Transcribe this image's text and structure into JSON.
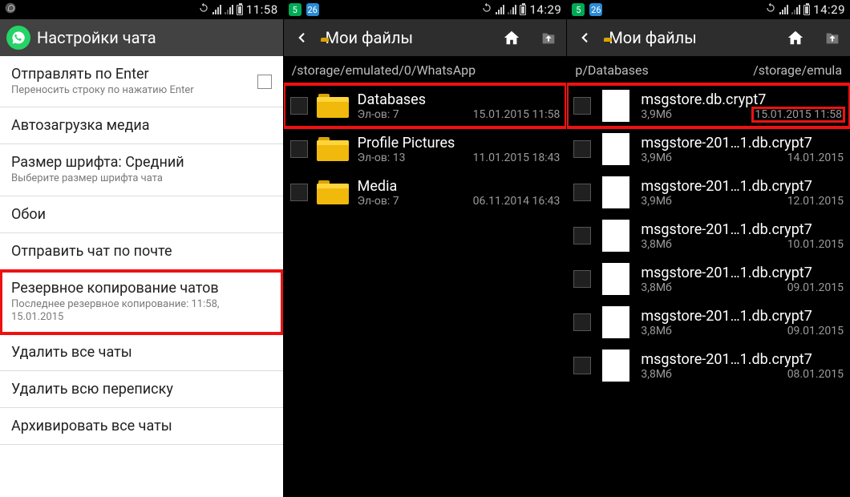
{
  "phone1": {
    "status": {
      "time": "11:58"
    },
    "header": {
      "title": "Настройки чата"
    },
    "items": [
      {
        "title": "Отправлять по Enter",
        "sub": "Переносить строку по нажатию Enter",
        "checkbox": true
      },
      {
        "title": "Автозагрузка медиа"
      },
      {
        "title": "Размер шрифта: Средний",
        "sub": "Выберите размер шрифта чата"
      },
      {
        "title": "Обои"
      },
      {
        "title": "Отправить чат по почте"
      },
      {
        "title": "Резервное копирование чатов",
        "sub": "Последнее резервное копирование: 11:58, 15.01.2015",
        "hl": true
      },
      {
        "title": "Удалить все чаты"
      },
      {
        "title": "Удалить всю переписку"
      },
      {
        "title": "Архивировать все чаты"
      }
    ]
  },
  "phone2": {
    "status": {
      "time": "14:29"
    },
    "header": {
      "title": "Мои файлы"
    },
    "path": "/storage/emulated/0/WhatsApp",
    "rows": [
      {
        "name": "Databases",
        "meta1": "Эл-ов: 7",
        "meta2": "15.01.2015 11:58",
        "hl": true
      },
      {
        "name": "Profile Pictures",
        "meta1": "Эл-ов: 13",
        "meta2": "11.01.2015 18:43"
      },
      {
        "name": "Media",
        "meta1": "Эл-ов: 7",
        "meta2": "06.11.2014 16:43"
      }
    ]
  },
  "phone3": {
    "status": {
      "time": "14:29"
    },
    "header": {
      "title": "Мои файлы"
    },
    "path1": "p/Databases",
    "path2": "/storage/emula",
    "rows": [
      {
        "name": "msgstore.db.crypt7",
        "meta1": "3,9Мб",
        "meta2": "15.01.2015 11:58",
        "hl": true,
        "dateHl": true
      },
      {
        "name": "msgstore-201…1.db.crypt7",
        "meta1": "3,9Мб",
        "meta2": "14.01.2015"
      },
      {
        "name": "msgstore-201…1.db.crypt7",
        "meta1": "3,9Мб",
        "meta2": "12.01.2015"
      },
      {
        "name": "msgstore-201…1.db.crypt7",
        "meta1": "3,8Мб",
        "meta2": "10.01.2015"
      },
      {
        "name": "msgstore-201…1.db.crypt7",
        "meta1": "3,8Мб",
        "meta2": "09.01.2015"
      },
      {
        "name": "msgstore-201…1.db.crypt7",
        "meta1": "3,8Мб",
        "meta2": "09.01.2015"
      },
      {
        "name": "msgstore-201…1.db.crypt7",
        "meta1": "3,8Мб",
        "meta2": "08.01.2015"
      }
    ]
  }
}
